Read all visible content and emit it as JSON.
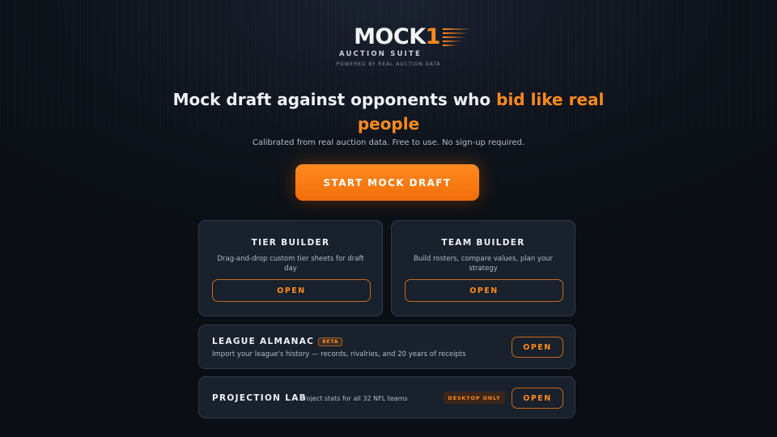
{
  "logo": {
    "word": "MOCK",
    "number": "1",
    "subtitle": "AUCTION SUITE",
    "powered": "POWERED BY REAL AUCTION DATA"
  },
  "hero": {
    "headline_main": "Mock draft against opponents who",
    "headline_accent": "bid like real people",
    "tagline": "Calibrated from real auction data. Free to use. No sign-up required.",
    "cta_label": "START MOCK DRAFT"
  },
  "tools": {
    "tier_builder": {
      "title": "TIER BUILDER",
      "description": "Drag-and-drop custom tier sheets for draft day",
      "button": "OPEN"
    },
    "team_builder": {
      "title": "TEAM BUILDER",
      "description": "Build rosters, compare values, plan your strategy",
      "button": "OPEN"
    },
    "league_almanac": {
      "title": "LEAGUE ALMANAC",
      "badge": "BETA",
      "description": "Import your league's history — records, rivalries, and 20 years of receipts",
      "button": "OPEN"
    },
    "projection_lab": {
      "title": "PROJECTION LAB",
      "description": "Project stats for all 32 NFL teams",
      "badge": "DESKTOP ONLY",
      "button": "OPEN"
    }
  },
  "colors": {
    "accent": "#ff8a1f",
    "background": "#0f141c",
    "card": "#1e2633"
  }
}
